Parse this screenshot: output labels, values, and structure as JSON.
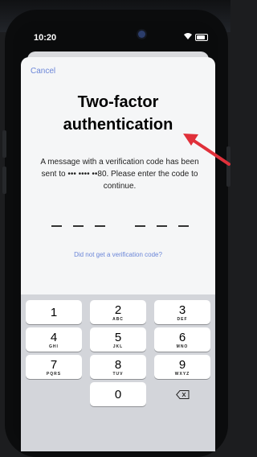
{
  "status": {
    "time": "10:20"
  },
  "sheet": {
    "cancel": "Cancel",
    "title_line1": "Two-factor",
    "title_line2": "authentication",
    "message": "A message with a verification code has been sent to ••• •••• ••80. Please enter the code to continue.",
    "resend_link": "Did not get a verification code?",
    "code_slots": 6
  },
  "keypad": {
    "keys": [
      {
        "digit": "1",
        "letters": ""
      },
      {
        "digit": "2",
        "letters": "ABC"
      },
      {
        "digit": "3",
        "letters": "DEF"
      },
      {
        "digit": "4",
        "letters": "GHI"
      },
      {
        "digit": "5",
        "letters": "JKL"
      },
      {
        "digit": "6",
        "letters": "MNO"
      },
      {
        "digit": "7",
        "letters": "PQRS"
      },
      {
        "digit": "8",
        "letters": "TUV"
      },
      {
        "digit": "9",
        "letters": "WXYZ"
      },
      {
        "digit": "0",
        "letters": ""
      }
    ],
    "delete_icon": "backspace-icon"
  },
  "colors": {
    "link": "#6b86d8",
    "annotation_arrow": "#e0303a",
    "keypad_bg": "#d3d5da"
  }
}
